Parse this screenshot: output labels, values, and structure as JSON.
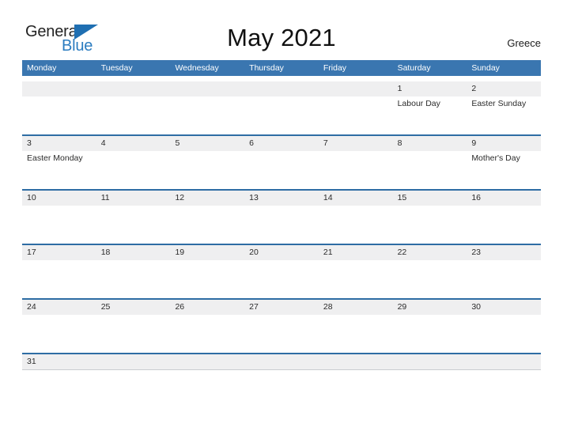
{
  "brand": {
    "line1": "General",
    "line2": "Blue"
  },
  "header": {
    "title": "May 2021",
    "region": "Greece"
  },
  "colors": {
    "header_blue": "#3a76b0",
    "row_border_blue": "#2e6da4",
    "date_band": "#efeff0",
    "logo_blue": "#2b7cc0",
    "text": "#2b2b2b"
  },
  "calendar": {
    "weekday_headers": [
      "Monday",
      "Tuesday",
      "Wednesday",
      "Thursday",
      "Friday",
      "Saturday",
      "Sunday"
    ],
    "weeks": [
      {
        "dates": [
          "",
          "",
          "",
          "",
          "",
          "1",
          "2"
        ],
        "events": [
          "",
          "",
          "",
          "",
          "",
          "Labour Day",
          "Easter Sunday"
        ]
      },
      {
        "dates": [
          "3",
          "4",
          "5",
          "6",
          "7",
          "8",
          "9"
        ],
        "events": [
          "Easter Monday",
          "",
          "",
          "",
          "",
          "",
          "Mother's Day"
        ]
      },
      {
        "dates": [
          "10",
          "11",
          "12",
          "13",
          "14",
          "15",
          "16"
        ],
        "events": [
          "",
          "",
          "",
          "",
          "",
          "",
          ""
        ]
      },
      {
        "dates": [
          "17",
          "18",
          "19",
          "20",
          "21",
          "22",
          "23"
        ],
        "events": [
          "",
          "",
          "",
          "",
          "",
          "",
          ""
        ]
      },
      {
        "dates": [
          "24",
          "25",
          "26",
          "27",
          "28",
          "29",
          "30"
        ],
        "events": [
          "",
          "",
          "",
          "",
          "",
          "",
          ""
        ]
      },
      {
        "dates": [
          "31",
          "",
          "",
          "",
          "",
          "",
          ""
        ],
        "events": [
          "",
          "",
          "",
          "",
          "",
          "",
          ""
        ]
      }
    ]
  }
}
